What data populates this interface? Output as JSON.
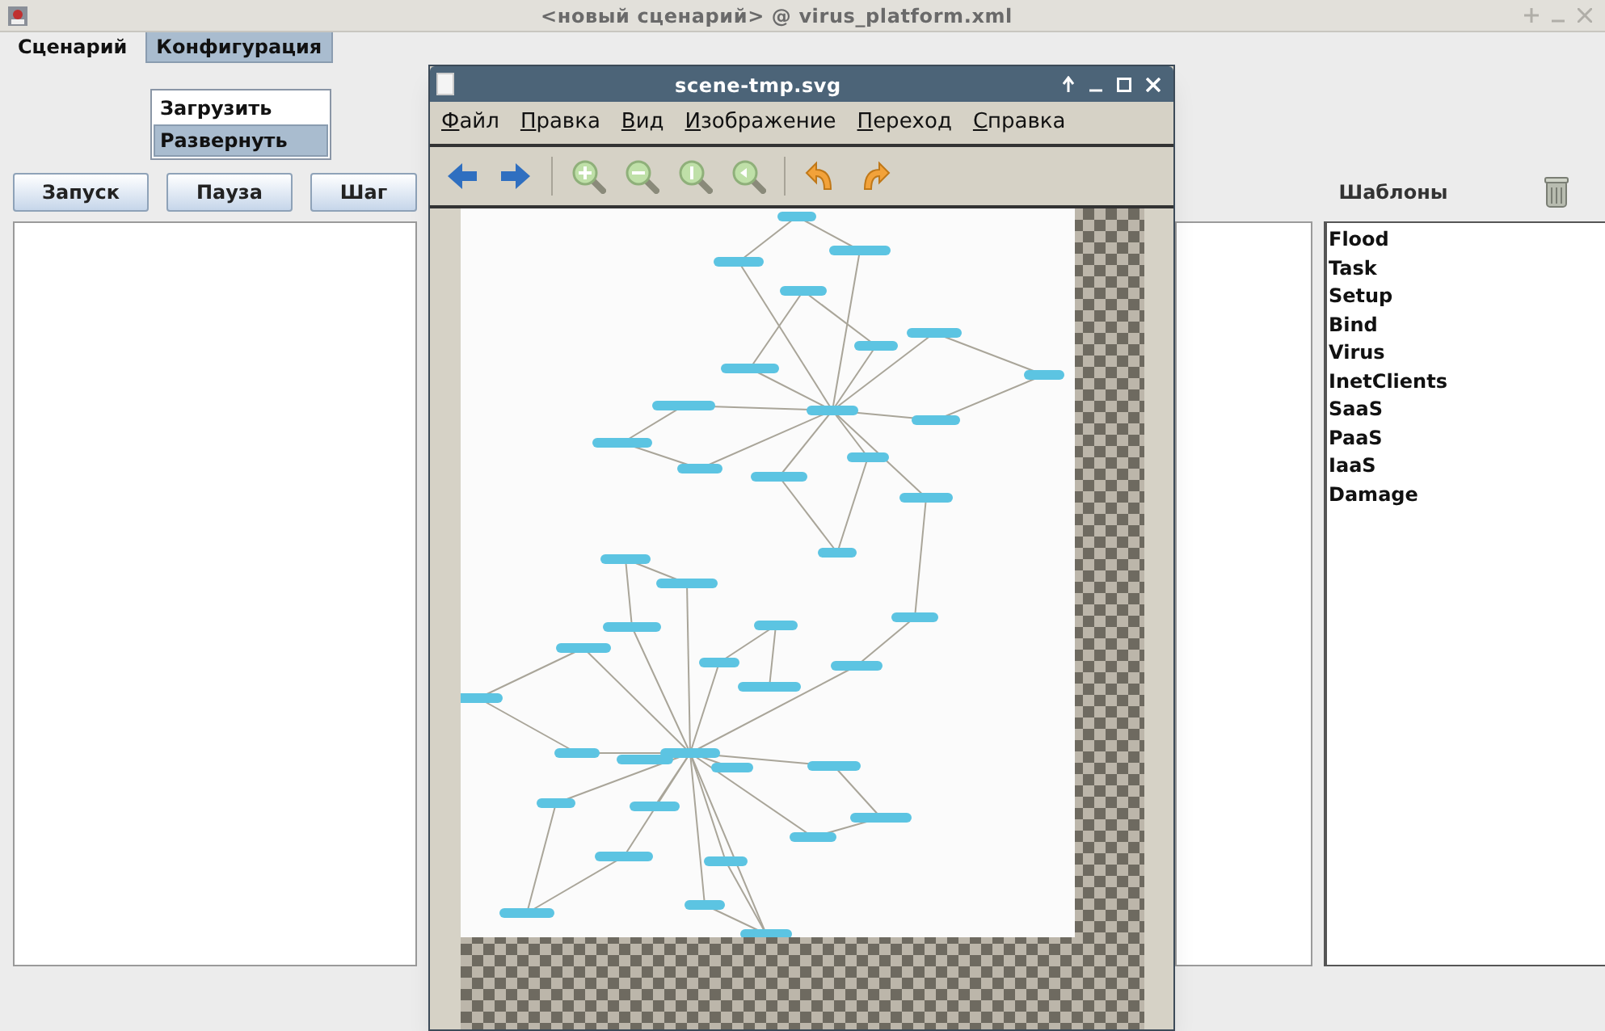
{
  "window": {
    "title": "<новый сценарий> @ virus_platform.xml"
  },
  "menu_bar": [
    {
      "label": "Сценарий",
      "selected": false
    },
    {
      "label": "Конфигурация",
      "selected": true
    }
  ],
  "open_menu": [
    {
      "label": "Загрузить",
      "selected": false
    },
    {
      "label": "Развернуть",
      "selected": true
    }
  ],
  "buttons": [
    "Запуск",
    "Пауза",
    "Шаг"
  ],
  "templates": {
    "title": "Шаблоны",
    "items": [
      "Flood",
      "Task",
      "Setup",
      "Bind",
      "Virus",
      "InetClients",
      "SaaS",
      "PaaS",
      "IaaS",
      "Damage"
    ]
  },
  "viewer": {
    "title": "scene-tmp.svg",
    "menu": [
      "Файл",
      "Правка",
      "Вид",
      "Изображение",
      "Переход",
      "Справка"
    ]
  }
}
